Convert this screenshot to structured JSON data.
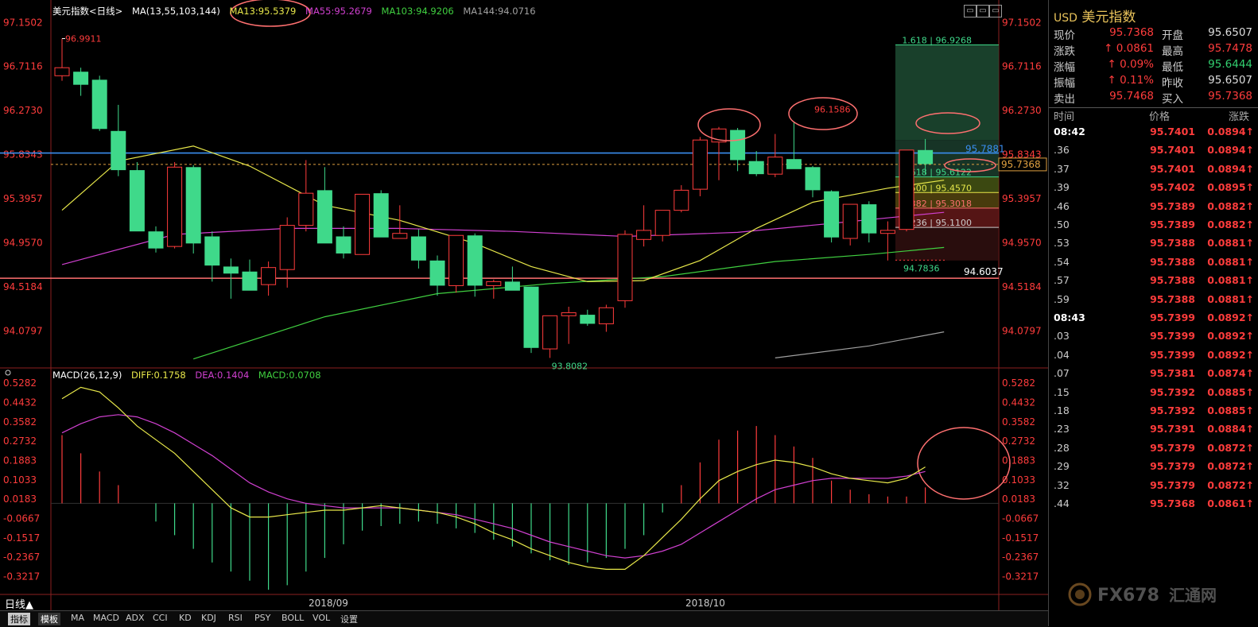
{
  "legend": {
    "title": "美元指数<日线>",
    "ma_params": "MA(13,55,103,144)",
    "ma13": "MA13:95.5379",
    "ma55": "MA55:95.2679",
    "ma103": "MA103:94.9206",
    "ma144": "MA144:94.0716"
  },
  "macd_legend": {
    "params": "MACD(26,12,9)",
    "diff": "DIFF:0.1758",
    "dea": "DEA:0.1404",
    "macd": "MACD:0.0708"
  },
  "colors": {
    "up": "#ff3c3c",
    "down": "#3fd98a",
    "ma13": "#e8e84a",
    "ma55": "#d040d0",
    "ma103": "#40d040",
    "ma144": "#a0a0a0",
    "blue_line": "#3a8ef0",
    "salmon": "#ff7070"
  },
  "chart_data": [
    {
      "type": "candlestick",
      "title": "美元指数<日线>",
      "y_ticks": [
        "97.1502",
        "96.7116",
        "96.2730",
        "95.8343",
        "95.3957",
        "94.9570",
        "94.5184",
        "94.0797"
      ],
      "ylim": [
        93.75,
        97.2
      ],
      "candles": [
        {
          "o": 96.62,
          "h": 96.99,
          "l": 96.57,
          "c": 96.7
        },
        {
          "o": 96.66,
          "h": 96.7,
          "l": 96.42,
          "c": 96.53
        },
        {
          "o": 96.58,
          "h": 96.62,
          "l": 96.07,
          "c": 96.09
        },
        {
          "o": 96.07,
          "h": 96.33,
          "l": 95.62,
          "c": 95.68
        },
        {
          "o": 95.68,
          "h": 95.76,
          "l": 95.08,
          "c": 95.07
        },
        {
          "o": 95.07,
          "h": 95.12,
          "l": 94.86,
          "c": 94.9
        },
        {
          "o": 94.92,
          "h": 95.76,
          "l": 94.9,
          "c": 95.71
        },
        {
          "o": 95.71,
          "h": 95.73,
          "l": 94.85,
          "c": 94.95
        },
        {
          "o": 95.02,
          "h": 95.07,
          "l": 94.57,
          "c": 94.73
        },
        {
          "o": 94.72,
          "h": 94.8,
          "l": 94.4,
          "c": 94.65
        },
        {
          "o": 94.67,
          "h": 94.79,
          "l": 94.5,
          "c": 94.48
        },
        {
          "o": 94.54,
          "h": 94.77,
          "l": 94.43,
          "c": 94.71
        },
        {
          "o": 94.69,
          "h": 95.21,
          "l": 94.51,
          "c": 95.13
        },
        {
          "o": 95.13,
          "h": 95.78,
          "l": 95.07,
          "c": 95.45
        },
        {
          "o": 95.48,
          "h": 95.71,
          "l": 95.05,
          "c": 94.95
        },
        {
          "o": 95.02,
          "h": 95.12,
          "l": 94.8,
          "c": 94.85
        },
        {
          "o": 94.84,
          "h": 95.42,
          "l": 94.84,
          "c": 95.44
        },
        {
          "o": 95.45,
          "h": 95.48,
          "l": 95.04,
          "c": 95.01
        },
        {
          "o": 95.0,
          "h": 95.33,
          "l": 95.0,
          "c": 95.05
        },
        {
          "o": 95.02,
          "h": 95.09,
          "l": 94.7,
          "c": 94.78
        },
        {
          "o": 94.78,
          "h": 94.83,
          "l": 94.43,
          "c": 94.53
        },
        {
          "o": 94.53,
          "h": 95.02,
          "l": 94.46,
          "c": 95.03
        },
        {
          "o": 95.03,
          "h": 95.05,
          "l": 94.42,
          "c": 94.53
        },
        {
          "o": 94.53,
          "h": 94.59,
          "l": 94.4,
          "c": 94.57
        },
        {
          "o": 94.57,
          "h": 94.72,
          "l": 94.49,
          "c": 94.48
        },
        {
          "o": 94.52,
          "h": 94.52,
          "l": 93.86,
          "c": 93.91
        },
        {
          "o": 93.9,
          "h": 94.23,
          "l": 93.81,
          "c": 94.23
        },
        {
          "o": 94.23,
          "h": 94.32,
          "l": 93.95,
          "c": 94.26
        },
        {
          "o": 94.24,
          "h": 94.29,
          "l": 94.13,
          "c": 94.15
        },
        {
          "o": 94.15,
          "h": 94.34,
          "l": 94.07,
          "c": 94.31
        },
        {
          "o": 94.38,
          "h": 95.08,
          "l": 94.31,
          "c": 95.04
        },
        {
          "o": 94.99,
          "h": 95.33,
          "l": 94.92,
          "c": 95.08
        },
        {
          "o": 95.03,
          "h": 95.28,
          "l": 94.97,
          "c": 95.28
        },
        {
          "o": 95.28,
          "h": 95.53,
          "l": 95.26,
          "c": 95.48
        },
        {
          "o": 95.49,
          "h": 96.01,
          "l": 95.42,
          "c": 95.98
        },
        {
          "o": 95.96,
          "h": 96.11,
          "l": 95.58,
          "c": 96.09
        },
        {
          "o": 96.08,
          "h": 96.1,
          "l": 95.67,
          "c": 95.78
        },
        {
          "o": 95.77,
          "h": 95.87,
          "l": 95.62,
          "c": 95.64
        },
        {
          "o": 95.64,
          "h": 96.04,
          "l": 95.61,
          "c": 95.81
        },
        {
          "o": 95.79,
          "h": 96.16,
          "l": 95.73,
          "c": 95.69
        },
        {
          "o": 95.71,
          "h": 95.72,
          "l": 95.41,
          "c": 95.48
        },
        {
          "o": 95.47,
          "h": 95.48,
          "l": 94.96,
          "c": 95.01
        },
        {
          "o": 95.0,
          "h": 95.33,
          "l": 94.93,
          "c": 95.34
        },
        {
          "o": 95.34,
          "h": 95.37,
          "l": 94.96,
          "c": 95.05
        },
        {
          "o": 95.05,
          "h": 95.17,
          "l": 94.78,
          "c": 95.08
        },
        {
          "o": 95.09,
          "h": 95.88,
          "l": 95.07,
          "c": 95.88
        },
        {
          "o": 95.88,
          "h": 95.99,
          "l": 95.64,
          "c": 95.74
        }
      ],
      "ma_points": {
        "ma13": [
          [
            0,
            95.28
          ],
          [
            3,
            95.77
          ],
          [
            7,
            95.92
          ],
          [
            10,
            95.72
          ],
          [
            14,
            95.33
          ],
          [
            18,
            95.18
          ],
          [
            22,
            94.95
          ],
          [
            25,
            94.72
          ],
          [
            28,
            94.57
          ],
          [
            31,
            94.58
          ],
          [
            34,
            94.78
          ],
          [
            37,
            95.1
          ],
          [
            40,
            95.36
          ],
          [
            44,
            95.5
          ],
          [
            47,
            95.58
          ]
        ],
        "ma55": [
          [
            0,
            94.74
          ],
          [
            6,
            95.04
          ],
          [
            12,
            95.1
          ],
          [
            18,
            95.1
          ],
          [
            24,
            95.07
          ],
          [
            30,
            95.02
          ],
          [
            36,
            95.06
          ],
          [
            41,
            95.15
          ],
          [
            47,
            95.26
          ]
        ],
        "ma103": [
          [
            7,
            93.8
          ],
          [
            14,
            94.22
          ],
          [
            20,
            94.45
          ],
          [
            26,
            94.55
          ],
          [
            32,
            94.62
          ],
          [
            38,
            94.77
          ],
          [
            43,
            94.84
          ],
          [
            47,
            94.91
          ]
        ],
        "ma144": [
          [
            38,
            93.81
          ],
          [
            43,
            93.93
          ],
          [
            47,
            94.07
          ]
        ]
      },
      "annotations": {
        "high_label": "96.9911",
        "low_label": "93.8082",
        "peak_label": "96.1586",
        "swing_low_label": "94.7836",
        "support_label": "94.6037",
        "current_label": "95.7368",
        "blue_label": "95.7881",
        "fib_labels": [
          "1.618 | 96.9268",
          "0.618 | 95.6122",
          "0.500 | 95.4570",
          "0.382 | 95.3018",
          "0.236 | 95.1100"
        ]
      }
    },
    {
      "type": "macd",
      "y_ticks": [
        "0.5282",
        "0.4432",
        "0.3582",
        "0.2732",
        "0.1883",
        "0.1033",
        "0.0183",
        "-0.0667",
        "-0.1517",
        "-0.2367",
        "-0.3217"
      ],
      "ylim": [
        -0.39,
        0.55
      ],
      "hist": [
        0.3,
        0.22,
        0.14,
        0.08,
        0.0,
        -0.08,
        -0.14,
        -0.2,
        -0.26,
        -0.3,
        -0.34,
        -0.38,
        -0.36,
        -0.3,
        -0.24,
        -0.18,
        -0.12,
        -0.1,
        -0.09,
        -0.08,
        -0.09,
        -0.11,
        -0.13,
        -0.16,
        -0.19,
        -0.22,
        -0.25,
        -0.27,
        -0.26,
        -0.24,
        -0.2,
        -0.14,
        -0.04,
        0.08,
        0.18,
        0.28,
        0.32,
        0.34,
        0.3,
        0.25,
        0.2,
        0.1,
        0.06,
        0.04,
        0.03,
        0.03,
        0.07
      ],
      "diff": [
        0.46,
        0.51,
        0.49,
        0.42,
        0.34,
        0.28,
        0.22,
        0.14,
        0.06,
        -0.02,
        -0.06,
        -0.06,
        -0.05,
        -0.04,
        -0.03,
        -0.03,
        -0.02,
        -0.01,
        -0.02,
        -0.03,
        -0.04,
        -0.06,
        -0.09,
        -0.13,
        -0.16,
        -0.2,
        -0.23,
        -0.26,
        -0.28,
        -0.29,
        -0.29,
        -0.23,
        -0.15,
        -0.07,
        0.02,
        0.1,
        0.14,
        0.17,
        0.19,
        0.18,
        0.16,
        0.13,
        0.11,
        0.1,
        0.09,
        0.11,
        0.16
      ],
      "dea": [
        0.31,
        0.35,
        0.38,
        0.39,
        0.38,
        0.35,
        0.31,
        0.26,
        0.21,
        0.15,
        0.09,
        0.05,
        0.02,
        0.0,
        -0.01,
        -0.02,
        -0.02,
        -0.02,
        -0.02,
        -0.03,
        -0.04,
        -0.05,
        -0.07,
        -0.09,
        -0.11,
        -0.14,
        -0.17,
        -0.19,
        -0.21,
        -0.23,
        -0.24,
        -0.23,
        -0.21,
        -0.18,
        -0.13,
        -0.08,
        -0.03,
        0.02,
        0.06,
        0.08,
        0.1,
        0.11,
        0.11,
        0.11,
        0.11,
        0.12,
        0.14
      ]
    }
  ],
  "x_labels": [
    "2018/09",
    "2018/10"
  ],
  "period_tag": "日线▲",
  "tabs": [
    "指标",
    "模板",
    "MA",
    "MACD",
    "ADX",
    "CCI",
    "KD",
    "KDJ",
    "RSI",
    "PSY",
    "BOLL",
    "VOL",
    "设置"
  ],
  "panel": {
    "code": "USD",
    "name": "美元指数",
    "quotes": [
      {
        "l": "现价",
        "v": "95.7368",
        "vc": "red",
        "l2": "开盘",
        "v2": "95.6507",
        "v2c": "wht"
      },
      {
        "l": "涨跌",
        "v": "↑ 0.0861",
        "vc": "red",
        "l2": "最高",
        "v2": "95.7478",
        "v2c": "red"
      },
      {
        "l": "涨幅",
        "v": "↑ 0.09%",
        "vc": "red",
        "l2": "最低",
        "v2": "95.6444",
        "v2c": "grn"
      },
      {
        "l": "振幅",
        "v": "↑ 0.11%",
        "vc": "red",
        "l2": "昨收",
        "v2": "95.6507",
        "v2c": "wht"
      },
      {
        "l": "卖出",
        "v": "95.7468",
        "vc": "red",
        "l2": "买入",
        "v2": "95.7368",
        "v2c": "red"
      }
    ],
    "tick_header": {
      "time": "时间",
      "price": "价格",
      "chg": "涨跌"
    },
    "ticks": [
      {
        "t": "08:42",
        "p": "95.7401",
        "c": "0.0894↑",
        "b": true
      },
      {
        "t": ".36",
        "p": "95.7401",
        "c": "0.0894↑"
      },
      {
        "t": ".37",
        "p": "95.7401",
        "c": "0.0894↑"
      },
      {
        "t": ".39",
        "p": "95.7402",
        "c": "0.0895↑"
      },
      {
        "t": ".46",
        "p": "95.7389",
        "c": "0.0882↑"
      },
      {
        "t": ".50",
        "p": "95.7389",
        "c": "0.0882↑"
      },
      {
        "t": ".53",
        "p": "95.7388",
        "c": "0.0881↑"
      },
      {
        "t": ".54",
        "p": "95.7388",
        "c": "0.0881↑"
      },
      {
        "t": ".57",
        "p": "95.7388",
        "c": "0.0881↑"
      },
      {
        "t": ".59",
        "p": "95.7388",
        "c": "0.0881↑"
      },
      {
        "t": "08:43",
        "p": "95.7399",
        "c": "0.0892↑",
        "b": true
      },
      {
        "t": ".03",
        "p": "95.7399",
        "c": "0.0892↑"
      },
      {
        "t": ".04",
        "p": "95.7399",
        "c": "0.0892↑"
      },
      {
        "t": ".07",
        "p": "95.7381",
        "c": "0.0874↑"
      },
      {
        "t": ".15",
        "p": "95.7392",
        "c": "0.0885↑"
      },
      {
        "t": ".18",
        "p": "95.7392",
        "c": "0.0885↑"
      },
      {
        "t": ".23",
        "p": "95.7391",
        "c": "0.0884↑"
      },
      {
        "t": ".28",
        "p": "95.7379",
        "c": "0.0872↑"
      },
      {
        "t": ".29",
        "p": "95.7379",
        "c": "0.0872↑"
      },
      {
        "t": ".32",
        "p": "95.7379",
        "c": "0.0872↑"
      },
      {
        "t": ".44",
        "p": "95.7368",
        "c": "0.0861↑"
      }
    ]
  },
  "logo": {
    "text1": "FX678",
    "text2": "汇通网"
  }
}
